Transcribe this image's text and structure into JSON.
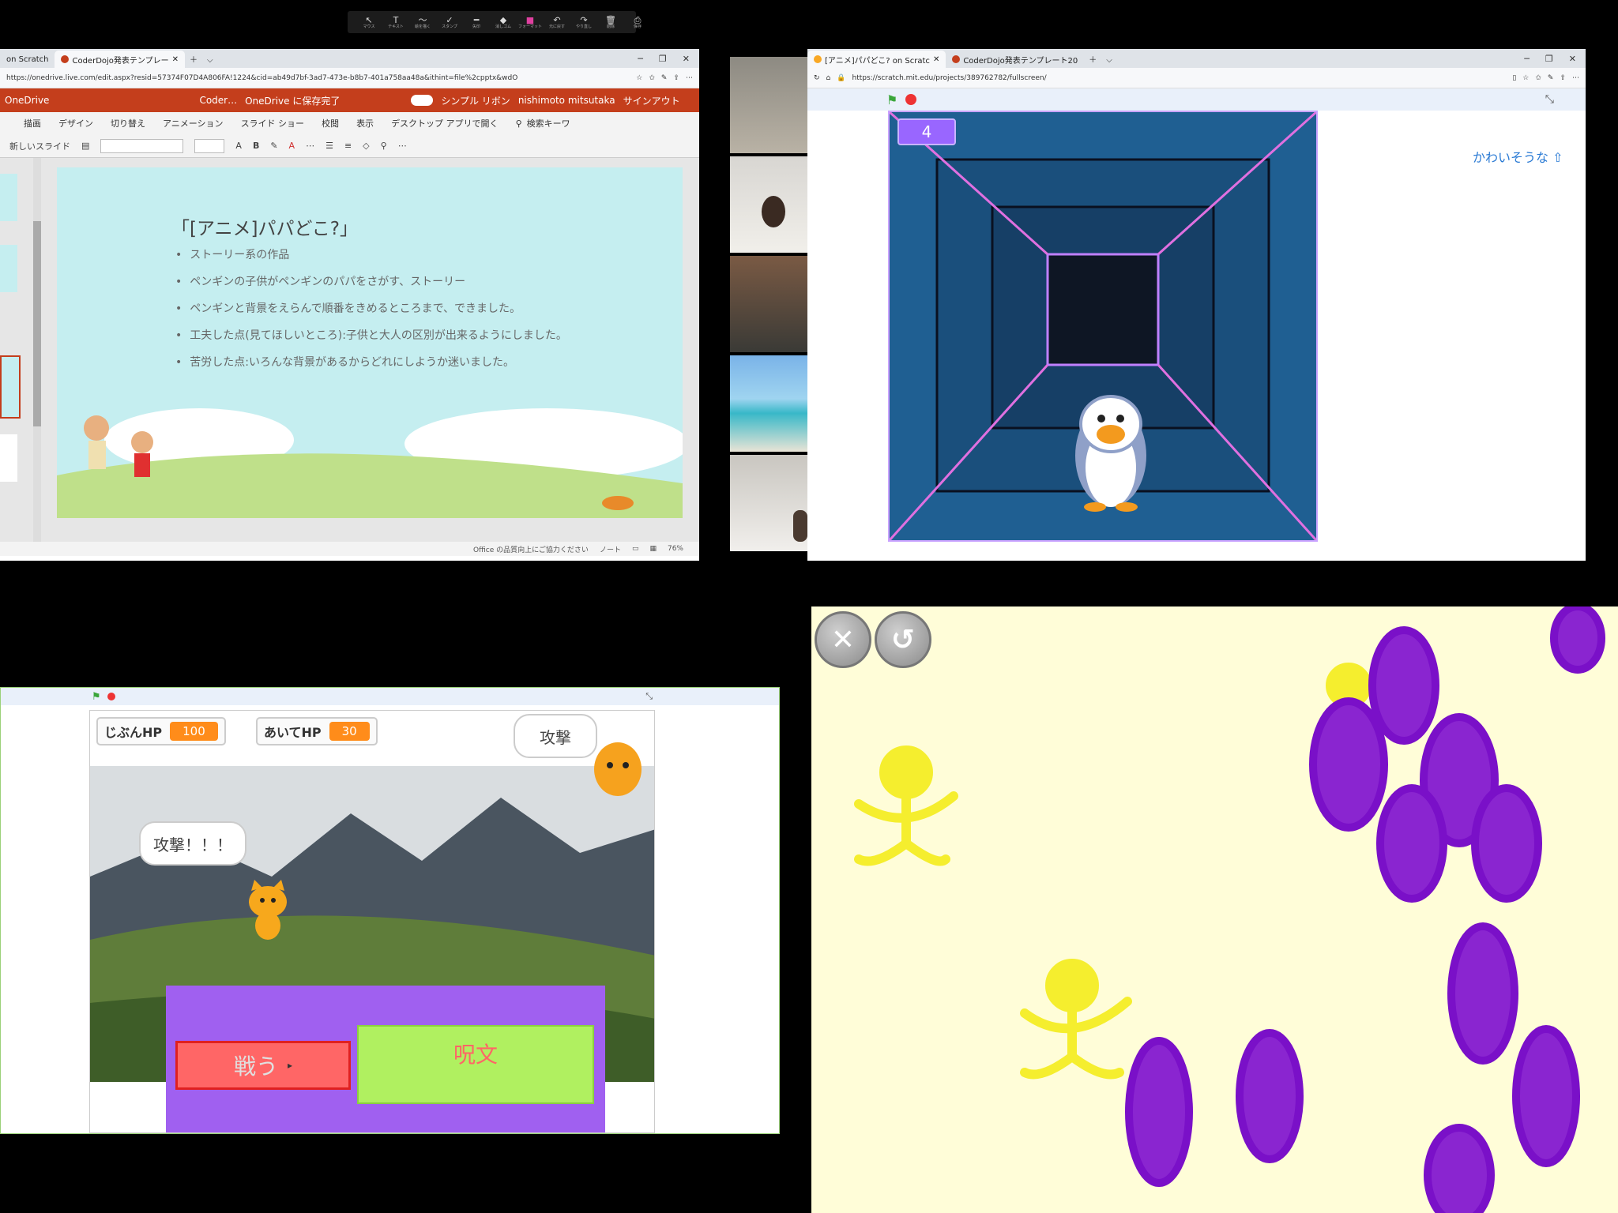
{
  "annotation_toolbar": {
    "tools": [
      {
        "glyph": "↖",
        "label": "マウス"
      },
      {
        "glyph": "T",
        "label": "テキスト"
      },
      {
        "glyph": "～",
        "label": "絵を描く"
      },
      {
        "glyph": "✓",
        "label": "スタンプ"
      },
      {
        "glyph": "━",
        "label": "矢印"
      },
      {
        "glyph": "◆",
        "label": "消しゴム"
      },
      {
        "glyph": "■",
        "label": "フォーマット"
      },
      {
        "glyph": "↶",
        "label": "元に戻す"
      },
      {
        "glyph": "↷",
        "label": "やり直し"
      },
      {
        "glyph": "🗑",
        "label": "削除"
      },
      {
        "glyph": "⎙",
        "label": "保存"
      }
    ]
  },
  "ppt_window": {
    "tab_prev": "on Scratch",
    "tab_active": "CoderDojo発表テンプレー",
    "url": "https://onedrive.live.com/edit.aspx?resid=57374F07D4A806FA!1224&cid=ab49d7bf-3ad7-473e-b8b7-401a758aa48a&ithint=file%2cpptx&wdO",
    "app_name": "OneDrive",
    "doc_title": "Coder…",
    "save_status": "OneDrive に保存完了",
    "simple_ribbon": "シンプル リボン",
    "user_name": "nishimoto mitsutaka",
    "signout": "サインアウト",
    "menu": [
      "描画",
      "デザイン",
      "切り替え",
      "アニメーション",
      "スライド ショー",
      "校閲",
      "表示",
      "デスクトップ アプリで開く",
      "検索キーワ"
    ],
    "new_slide": "新しいスライド",
    "slide": {
      "title": "「[アニメ]パパどこ?」",
      "bullets": [
        "ストーリー系の作品",
        "ペンギンの子供がペンギンのパパをさがす、ストーリー",
        "ペンギンと背景をえらんで順番をきめるところまで、できました。",
        "工夫した点(見てほしいところ):子供と大人の区別が出来るようにしました。",
        "苦労した点:いろんな背景があるからどれにしようか迷いました。"
      ]
    },
    "status": {
      "feedback": "Office の品質向上にご協力ください",
      "notes": "ノート",
      "zoom": "76%"
    }
  },
  "scratch_window": {
    "tab_active": "[アニメ]パパどこ? on Scratc",
    "tab_second": "CoderDojo発表テンプレート20",
    "url": "https://scratch.mit.edu/projects/389762782/fullscreen/",
    "counter": "4",
    "side_link": "かわいそうな"
  },
  "battle_game": {
    "my_hp_label": "じぶんHP",
    "my_hp": "100",
    "enemy_hp_label": "あいてHP",
    "enemy_hp": "30",
    "enemy_bubble": "攻撃",
    "cat_bubble": "攻撃！！！",
    "fight_button": "戦う",
    "spell_button": "呪文"
  },
  "colors": {
    "ppt_red": "#c43e1c",
    "scratch_purple": "#9966ff",
    "hp_orange": "#ff8c1a",
    "drawing_bg": "#fffdd8"
  }
}
